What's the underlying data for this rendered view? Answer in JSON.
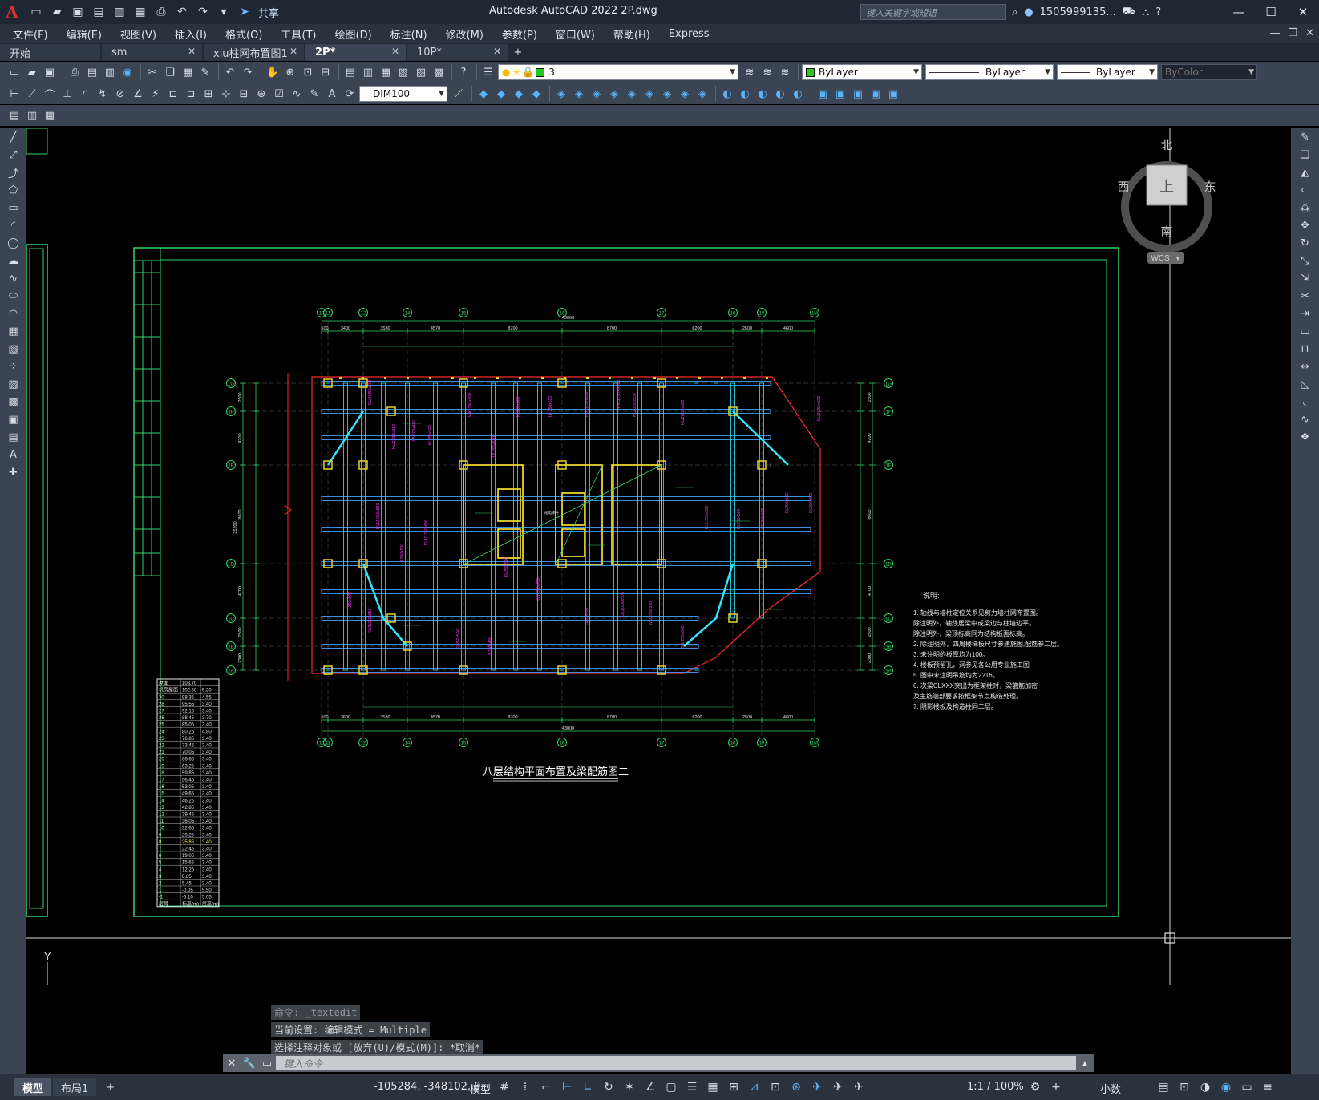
{
  "titlebar": {
    "logo": "A",
    "share_label": "共享",
    "app_title": "Autodesk AutoCAD 2022    2P.dwg",
    "search_placeholder": "键入关键字或短语",
    "user": "1505999135...",
    "help": "?"
  },
  "menu": [
    "文件(F)",
    "编辑(E)",
    "视图(V)",
    "插入(I)",
    "格式(O)",
    "工具(T)",
    "绘图(D)",
    "标注(N)",
    "修改(M)",
    "参数(P)",
    "窗口(W)",
    "帮助(H)",
    "Express"
  ],
  "tabs": [
    {
      "label": "开始",
      "closable": false,
      "active": false
    },
    {
      "label": "sm",
      "closable": true,
      "active": false
    },
    {
      "label": "xiu柱网布置图1",
      "closable": true,
      "active": false
    },
    {
      "label": "2P*",
      "closable": true,
      "active": true
    },
    {
      "label": "10P*",
      "closable": true,
      "active": false
    }
  ],
  "toolbar": {
    "layer_value": "3",
    "color_value": "ByLayer",
    "linetype_value": "ByLayer",
    "lineweight_value": "ByLayer",
    "plotstyle_value": "ByColor",
    "dimstyle_value": "DIM100"
  },
  "viewcube": {
    "north": "北",
    "south": "南",
    "east": "东",
    "west": "西",
    "top": "上",
    "wcs": "WCS"
  },
  "drawing": {
    "title": "八层结构平面布置及梁配筋图二",
    "notes_heading": "说明:",
    "notes": [
      "1.  轴线与墙柱定位关系见剪力墙柱网布置图。",
      "     除注明外，轴线居梁中或梁边与柱墙边平。",
      "     除注明外，梁顶标高同为结构板面标高。",
      "2.  除注明外，四周楼梯板尺寸参建施图,配筋参二层。",
      "3.  未注明的板厚均为100。",
      "4.  楼板预留孔，洞参见各公用专业施工图",
      "5.  图中未注明吊筋均为2?16。",
      "6.  次梁CLXXX突出为框架柱时，梁箍筋加密",
      "     及主筋端部要求按框架节点构造处理。",
      "7.  阴影楼板及构造柱同二层。"
    ],
    "top_axes": [
      "10",
      "11",
      "12",
      "14",
      "15",
      "16",
      "17",
      "18",
      "19",
      "1M"
    ],
    "right_axes": [
      "1G",
      "1F",
      "1E",
      "1D",
      "1C",
      "1B",
      "1A"
    ],
    "top_total": "43000",
    "top_dims": [
      "500",
      "3400",
      "3530",
      "4570",
      "8700",
      "8700",
      "6200",
      "2500",
      "4600"
    ],
    "bottom_dims": [
      "500",
      "3600",
      "3530",
      "4570",
      "8700",
      "8700",
      "6200",
      "2500",
      "4600"
    ],
    "bottom_total": "43000",
    "left_total": "25200",
    "left_dims": [
      "2500",
      "4700",
      "8600",
      "4700",
      "2500",
      "2300"
    ],
    "floor_table": {
      "header": [
        "层号",
        "标高(m)",
        "层高(m)"
      ],
      "rows": [
        [
          "屋面",
          "108.70",
          ""
        ],
        [
          "机房屋面",
          "102.50",
          "5.20"
        ],
        [
          "30",
          "98.35",
          "4.55"
        ],
        [
          "28",
          "95.55",
          "3.40"
        ],
        [
          "27",
          "92.15",
          "3.40"
        ],
        [
          "26",
          "88.45",
          "3.70"
        ],
        [
          "25",
          "85.05",
          "3.40"
        ],
        [
          "24",
          "80.25",
          "4.80"
        ],
        [
          "23",
          "76.85",
          "3.40"
        ],
        [
          "22",
          "73.45",
          "3.40"
        ],
        [
          "21",
          "70.05",
          "3.40"
        ],
        [
          "20",
          "66.65",
          "3.40"
        ],
        [
          "19",
          "63.25",
          "3.40"
        ],
        [
          "18",
          "59.85",
          "3.40"
        ],
        [
          "17",
          "56.45",
          "3.40"
        ],
        [
          "16",
          "53.05",
          "3.40"
        ],
        [
          "15",
          "49.65",
          "3.40"
        ],
        [
          "14",
          "46.25",
          "3.40"
        ],
        [
          "13",
          "42.85",
          "3.40"
        ],
        [
          "12",
          "39.45",
          "3.40"
        ],
        [
          "11",
          "36.05",
          "3.40"
        ],
        [
          "10",
          "32.65",
          "3.40"
        ],
        [
          "9",
          "29.25",
          "3.40"
        ],
        [
          "8",
          "25.85",
          "3.40"
        ],
        [
          "7",
          "22.45",
          "3.40"
        ],
        [
          "6",
          "19.05",
          "3.40"
        ],
        [
          "5",
          "15.65",
          "3.40"
        ],
        [
          "4",
          "12.25",
          "3.40"
        ],
        [
          "3",
          "8.85",
          "3.40"
        ],
        [
          "2",
          "5.45",
          "3.40"
        ],
        [
          "1",
          "-0.05",
          "5.50"
        ],
        [
          "-1",
          "-5.10",
          "5.05"
        ]
      ]
    },
    "core_label": "楼电梯井"
  },
  "command": {
    "history": [
      "命令: _textedit",
      "当前设置: 编辑模式 = Multiple",
      "选择注释对象或 [放弃(U)/模式(M)]: *取消*"
    ],
    "placeholder": "键入命令"
  },
  "statusbar": {
    "model_tab": "模型",
    "layout_tab": "布局1",
    "coords": "-105284, -348102, 0",
    "mode": "模型",
    "scale": "1:1 / 100%",
    "units": "小数"
  }
}
